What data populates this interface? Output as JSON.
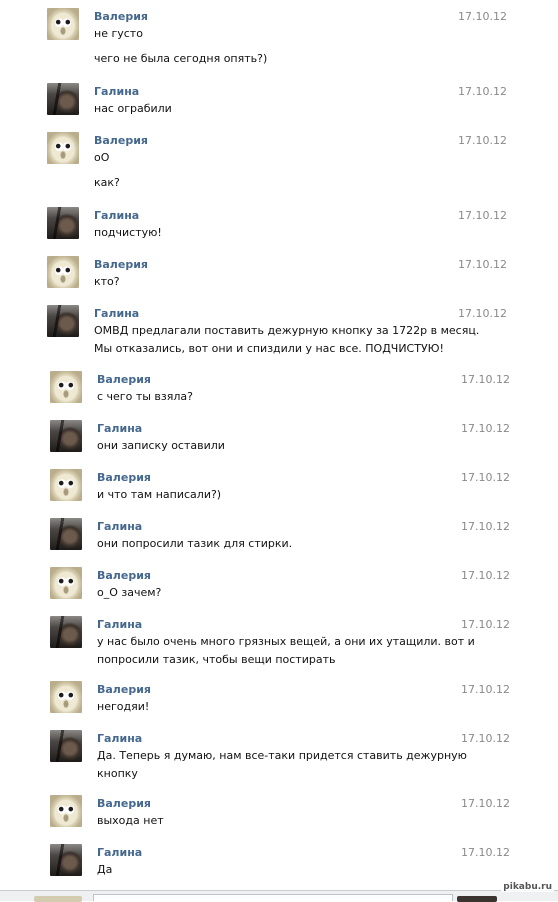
{
  "messages": [
    {
      "author": "Валерия",
      "avatar": "cat-avatar",
      "date": "17.10.12",
      "lines": [
        "не густо",
        "чего не была сегодня опять?)"
      ]
    },
    {
      "author": "Галина",
      "avatar": "dark-portrait-avatar",
      "date": "17.10.12",
      "lines": [
        "нас ограбили"
      ]
    },
    {
      "author": "Валерия",
      "avatar": "cat-avatar",
      "date": "17.10.12",
      "lines": [
        "оО",
        "как?"
      ]
    },
    {
      "author": "Галина",
      "avatar": "dark-portrait-avatar",
      "date": "17.10.12",
      "lines": [
        "подчистую!"
      ]
    },
    {
      "author": "Валерия",
      "avatar": "cat-avatar",
      "date": "17.10.12",
      "lines": [
        "кто?"
      ]
    },
    {
      "author": "Галина",
      "avatar": "dark-portrait-avatar",
      "date": "17.10.12",
      "lines": [
        "ОМВД предлагали поставить дежурную кнопку за 1722р в месяц.",
        "Мы отказались, вот они и спиздили у нас все. ПОДЧИСТУЮ!"
      ]
    },
    {
      "author": "Валерия",
      "avatar": "cat-avatar",
      "date": "17.10.12",
      "lines": [
        "с чего ты взяла?"
      ]
    },
    {
      "author": "Галина",
      "avatar": "dark-portrait-avatar",
      "date": "17.10.12",
      "lines": [
        "они записку оставили"
      ]
    },
    {
      "author": "Валерия",
      "avatar": "cat-avatar",
      "date": "17.10.12",
      "lines": [
        "и что там написали?)"
      ]
    },
    {
      "author": "Галина",
      "avatar": "dark-portrait-avatar",
      "date": "17.10.12",
      "lines": [
        "они попросили тазик для стирки."
      ]
    },
    {
      "author": "Валерия",
      "avatar": "cat-avatar",
      "date": "17.10.12",
      "lines": [
        "о_О зачем?"
      ]
    },
    {
      "author": "Галина",
      "avatar": "dark-portrait-avatar",
      "date": "17.10.12",
      "lines": [
        "у нас было очень много грязных вещей, а они их утащили. вот и",
        "попросили тазик, чтобы вещи постирать"
      ]
    },
    {
      "author": "Валерия",
      "avatar": "cat-avatar",
      "date": "17.10.12",
      "lines": [
        "негодяи!"
      ]
    },
    {
      "author": "Галина",
      "avatar": "dark-portrait-avatar",
      "date": "17.10.12",
      "lines": [
        "Да. Теперь я думаю, нам все-таки придется ставить дежурную",
        "кнопку"
      ]
    },
    {
      "author": "Валерия",
      "avatar": "cat-avatar",
      "date": "17.10.12",
      "lines": [
        "выхода нет"
      ]
    },
    {
      "author": "Галина",
      "avatar": "dark-portrait-avatar",
      "date": "17.10.12",
      "lines": [
        "Да"
      ]
    }
  ],
  "watermark": "pikabu.ru"
}
